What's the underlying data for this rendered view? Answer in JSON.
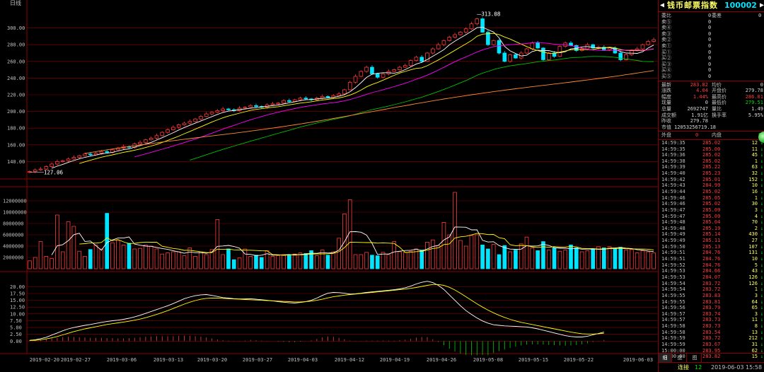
{
  "chart": {
    "period_label": "日线",
    "colors": {
      "up": "#ff3c3c",
      "down": "#00e5ff",
      "ma5": "#ffffff",
      "ma10": "#ffff00",
      "ma20": "#ff00ff",
      "ma60": "#00c000",
      "ma120": "#ff8c32",
      "grid": "#8b0000",
      "axis": "#c0c0c0"
    },
    "price_axis": {
      "min": 120,
      "max": 320,
      "ticks": [
        140,
        160,
        180,
        200,
        220,
        240,
        260,
        280,
        300
      ]
    },
    "volume_axis": {
      "max": 13000000,
      "ticks": [
        "2000000",
        "4000000",
        "6000000",
        "8000000",
        "10000000",
        "12000000"
      ]
    },
    "indicator_axis": {
      "min": -2,
      "max": 24,
      "ticks": [
        "0.00",
        "2.50",
        "5.00",
        "7.50",
        "10.00",
        "12.50",
        "15.00",
        "17.50",
        "20.00"
      ]
    },
    "dates": [
      "2019-02-20",
      "2019-02-27",
      "2019-03-06",
      "2019-03-13",
      "2019-03-20",
      "2019-03-27",
      "2019-04-03",
      "2019-04-12",
      "2019-04-19",
      "2019-04-26",
      "2019-05-08",
      "2019-05-15",
      "2019-05-22",
      "2019-06-03"
    ],
    "high_label": "313.08",
    "low_label": "127.06"
  },
  "chart_data": {
    "type": "candlestick",
    "closes": [
      128,
      130,
      131,
      134,
      137,
      140,
      141,
      143,
      145,
      147,
      149,
      148,
      150,
      152,
      151,
      154,
      156,
      158,
      157,
      161,
      163,
      166,
      168,
      171,
      175,
      178,
      181,
      184,
      186,
      188,
      191,
      194,
      197,
      199,
      201,
      203,
      202,
      201,
      204,
      205,
      207,
      206,
      205,
      208,
      209,
      210,
      213,
      212,
      214,
      216,
      215,
      214,
      216,
      218,
      217,
      219,
      221,
      226,
      235,
      242,
      248,
      253,
      245,
      241,
      245,
      248,
      250,
      253,
      255,
      261,
      265,
      260,
      270,
      275,
      280,
      285,
      289,
      292,
      295,
      299,
      305,
      311,
      295,
      280,
      285,
      270,
      260,
      268,
      264,
      270,
      275,
      282,
      276,
      262,
      270,
      266,
      278,
      282,
      279,
      273,
      275,
      280,
      276,
      277,
      274,
      276,
      270,
      262,
      268,
      273,
      275,
      280,
      284,
      286
    ],
    "volumes": [
      1400000,
      2000000,
      4800000,
      2200000,
      1800000,
      9500000,
      3000000,
      8300000,
      7500000,
      3100000,
      2200000,
      3400000,
      4200000,
      3500000,
      9800000,
      4600000,
      5000000,
      4200000,
      4500000,
      3500000,
      3600000,
      4200000,
      4000000,
      3500000,
      2600000,
      2800000,
      3000000,
      3000000,
      2300000,
      3700000,
      2200000,
      3000000,
      2500000,
      3400000,
      8700000,
      2500000,
      3500000,
      1600000,
      1900000,
      3500000,
      2200000,
      2400000,
      2000000,
      3200000,
      2200000,
      2300000,
      2500000,
      2400000,
      2600000,
      2800000,
      2700000,
      3200000,
      2300000,
      3300000,
      2400000,
      3000000,
      5400000,
      9700000,
      12200000,
      2500000,
      2500000,
      2900000,
      2400000,
      2300000,
      2900000,
      2500000,
      4800000,
      3000000,
      2900000,
      3100000,
      3500000,
      3300000,
      4700000,
      5100000,
      4100000,
      8200000,
      6000000,
      13500000,
      5000000,
      4000000,
      5900000,
      6000000,
      4200000,
      3500000,
      4300000,
      2500000,
      4100000,
      3000000,
      3300000,
      4400000,
      5600000,
      3700000,
      3200000,
      4800000,
      3300000,
      3700000,
      3100000,
      3300000,
      4200000,
      3700000,
      3000000,
      3200000,
      3400000,
      3900000,
      3700000,
      3900000,
      3500000,
      3800000,
      3300000,
      3400000,
      2800000,
      3200000,
      3000000,
      2800000
    ],
    "indicator_line1": [
      0.3,
      0.5,
      0.9,
      1.4,
      2.2,
      3.0,
      3.8,
      4.5,
      5.0,
      5.4,
      5.8,
      6.1,
      6.5,
      6.9,
      7.2,
      7.5,
      7.7,
      8.0,
      8.4,
      8.9,
      9.5,
      10.2,
      10.9,
      11.6,
      12.3,
      13.0,
      13.8,
      14.7,
      15.6,
      16.2,
      16.7,
      17.0,
      17.1,
      16.8,
      16.4,
      16.0,
      15.8,
      15.6,
      15.5,
      15.5,
      15.6,
      15.4,
      15.2,
      15.0,
      14.8,
      14.5,
      14.3,
      14.1,
      14.0,
      14.2,
      14.5,
      15.0,
      15.8,
      16.8,
      17.6,
      17.9,
      17.8,
      17.6,
      17.3,
      17.4,
      17.6,
      17.9,
      18.1,
      18.3,
      18.5,
      18.7,
      18.9,
      19.2,
      19.6,
      20.2,
      21.0,
      21.6,
      22.0,
      21.5,
      20.5,
      19.0,
      17.0,
      15.0,
      13.0,
      11.2,
      9.8,
      8.5,
      7.4,
      6.6,
      6.0,
      5.8,
      5.6,
      5.5,
      5.4,
      5.3,
      5.2,
      4.9,
      4.5,
      4.0,
      3.5,
      3.0,
      2.5,
      2.0,
      1.7,
      1.5,
      1.5,
      1.8,
      2.3,
      2.8,
      3.3
    ],
    "indicator_line2": [
      0.2,
      0.3,
      0.5,
      0.8,
      1.2,
      1.7,
      2.3,
      2.9,
      3.5,
      4.0,
      4.5,
      4.9,
      5.3,
      5.7,
      6.1,
      6.4,
      6.7,
      7.0,
      7.3,
      7.7,
      8.1,
      8.6,
      9.2,
      9.8,
      10.5,
      11.2,
      12.0,
      12.8,
      13.6,
      14.3,
      14.9,
      15.4,
      15.7,
      15.8,
      15.8,
      15.7,
      15.6,
      15.5,
      15.4,
      15.3,
      15.2,
      15.1,
      15.0,
      14.9,
      14.8,
      14.7,
      14.6,
      14.5,
      14.4,
      14.4,
      14.5,
      14.7,
      15.0,
      15.4,
      15.9,
      16.3,
      16.6,
      16.9,
      17.1,
      17.3,
      17.5,
      17.7,
      17.9,
      18.1,
      18.3,
      18.5,
      18.7,
      18.9,
      19.1,
      19.4,
      19.7,
      20.1,
      20.5,
      20.8,
      20.8,
      20.5,
      19.8,
      18.8,
      17.6,
      16.3,
      15.0,
      13.7,
      12.5,
      11.4,
      10.4,
      9.5,
      8.7,
      8.0,
      7.4,
      6.9,
      6.5,
      6.1,
      5.7,
      5.3,
      4.9,
      4.5,
      4.1,
      3.7,
      3.3,
      3.0,
      2.7,
      2.6,
      2.6,
      2.7,
      2.9
    ],
    "macd_bars": [
      0.3,
      0.4,
      0.6,
      0.8,
      1.0,
      1.2,
      1.5,
      1.6,
      1.5,
      1.4,
      1.3,
      1.2,
      1.2,
      1.2,
      1.1,
      1.1,
      1.0,
      1.0,
      1.1,
      1.2,
      1.4,
      1.6,
      1.7,
      1.8,
      1.8,
      1.8,
      1.8,
      1.9,
      2.0,
      1.9,
      1.8,
      1.6,
      1.4,
      1.0,
      0.6,
      0.3,
      0.2,
      0.1,
      0.1,
      0.2,
      0.4,
      0.3,
      0.2,
      0.1,
      0.0,
      -0.2,
      -0.3,
      -0.4,
      -0.4,
      -0.2,
      0.0,
      0.3,
      0.8,
      1.4,
      1.7,
      1.6,
      1.2,
      0.7,
      0.2,
      0.1,
      0.1,
      0.2,
      0.2,
      0.2,
      0.2,
      0.2,
      0.2,
      0.3,
      0.5,
      0.8,
      1.3,
      1.5,
      1.5,
      0.7,
      -0.3,
      -1.5,
      -2.8,
      -3.8,
      -4.6,
      -5.1,
      -5.2,
      -5.2,
      -5.1,
      -5.2,
      -4.4,
      -3.7,
      -3.1,
      -2.5,
      -2.0,
      -1.6,
      -1.3,
      -1.2,
      -1.2,
      -1.3,
      -1.4,
      -1.5,
      -1.6,
      -1.7,
      -1.6,
      -1.5,
      -1.2,
      -0.8,
      -0.3,
      0.1,
      0.4
    ]
  },
  "panel": {
    "name": "钱币邮票指数",
    "code": "100002",
    "order_book": [
      {
        "label": "委比",
        "v1": "0",
        "label2": "委差",
        "v2": "0"
      },
      {
        "label": "卖⑤",
        "v1": "",
        "v2": "0"
      },
      {
        "label": "卖④",
        "v1": "",
        "v2": "0"
      },
      {
        "label": "卖③",
        "v1": "",
        "v2": "0"
      },
      {
        "label": "卖②",
        "v1": "",
        "v2": "0"
      },
      {
        "label": "卖①",
        "v1": "",
        "v2": "0"
      },
      {
        "label": "买①",
        "v1": "",
        "v2": "0"
      },
      {
        "label": "买②",
        "v1": "",
        "v2": "0"
      },
      {
        "label": "买③",
        "v1": "",
        "v2": "0"
      },
      {
        "label": "买④",
        "v1": "",
        "v2": "0"
      },
      {
        "label": "买⑤",
        "v1": "",
        "v2": "0"
      }
    ],
    "quote": [
      {
        "l1": "最新",
        "v1": "283.82",
        "c1": "red",
        "l2": "均价",
        "v2": "0",
        "c2": "white"
      },
      {
        "l1": "涨跌",
        "v1": "4.04",
        "c1": "red",
        "l2": "开盘价",
        "v2": "279.78",
        "c2": "white"
      },
      {
        "l1": "幅度",
        "v1": "1.44%",
        "c1": "red",
        "l2": "最高价",
        "v2": "286.01",
        "c2": "red"
      },
      {
        "l1": "现量",
        "v1": "0",
        "c1": "white",
        "l2": "最低价",
        "v2": "279.51",
        "c2": "green"
      },
      {
        "l1": "总量",
        "v1": "2692747",
        "c1": "white",
        "l2": "量比",
        "v2": "1.49",
        "c2": "white"
      },
      {
        "l1": "成交额",
        "v1": "1.91亿",
        "c1": "white",
        "l2": "换手率",
        "v2": "5.95%",
        "c2": "white"
      },
      {
        "l1": "昨收",
        "v1": "279.78",
        "c1": "white",
        "l2": "",
        "v2": "",
        "c2": "white"
      },
      {
        "l1": "市值",
        "v1": "12053256719.18",
        "c1": "white",
        "l2": "",
        "v2": "",
        "c2": "white"
      }
    ],
    "inout": {
      "out_label": "外盘",
      "out": "0",
      "in_label": "内盘",
      "in": "0"
    },
    "trades": [
      {
        "t": "14:59:35",
        "p": "285.02",
        "v": "12",
        "d": "↓"
      },
      {
        "t": "14:59:35",
        "p": "285.00",
        "v": "11",
        "d": "↓"
      },
      {
        "t": "14:59:36",
        "p": "285.02",
        "v": "45",
        "d": "↓"
      },
      {
        "t": "14:59:38",
        "p": "285.02",
        "v": "1",
        "d": "↓"
      },
      {
        "t": "14:59:39",
        "p": "285.22",
        "v": "63",
        "d": "↓"
      },
      {
        "t": "14:59:40",
        "p": "285.23",
        "v": "32",
        "d": "↓"
      },
      {
        "t": "14:59:42",
        "p": "285.01",
        "v": "152",
        "d": "↓"
      },
      {
        "t": "14:59:43",
        "p": "284.99",
        "v": "10",
        "d": "↓"
      },
      {
        "t": "14:59:44",
        "p": "285.02",
        "v": "16",
        "d": "↓"
      },
      {
        "t": "14:59:46",
        "p": "285.05",
        "v": "1",
        "d": "↓"
      },
      {
        "t": "14:59:46",
        "p": "285.02",
        "v": "30",
        "d": "↓"
      },
      {
        "t": "14:59:47",
        "p": "285.09",
        "v": "3",
        "d": "↓"
      },
      {
        "t": "14:59:47",
        "p": "285.09",
        "v": "4",
        "d": "↓"
      },
      {
        "t": "14:59:48",
        "p": "285.04",
        "v": "70",
        "d": "↓"
      },
      {
        "t": "14:59:48",
        "p": "285.19",
        "v": "2",
        "d": "↓"
      },
      {
        "t": "14:59:49",
        "p": "285.14",
        "v": "430",
        "d": "↓"
      },
      {
        "t": "14:59:49",
        "p": "285.11",
        "v": "27",
        "d": "↓"
      },
      {
        "t": "14:59:50",
        "p": "285.13",
        "v": "107",
        "d": "↓"
      },
      {
        "t": "14:59:51",
        "p": "284.76",
        "v": "131",
        "d": "↓"
      },
      {
        "t": "14:59:51",
        "p": "284.76",
        "v": "10",
        "d": "↓"
      },
      {
        "t": "14:59:52",
        "p": "284.76",
        "v": "5",
        "d": "↓"
      },
      {
        "t": "14:59:53",
        "p": "284.66",
        "v": "43",
        "d": "↓"
      },
      {
        "t": "14:59:53",
        "p": "284.07",
        "v": "126",
        "d": "↓"
      },
      {
        "t": "14:59:54",
        "p": "283.72",
        "v": "126",
        "d": "↓"
      },
      {
        "t": "14:59:54",
        "p": "283.72",
        "v": "1",
        "d": "↓"
      },
      {
        "t": "14:59:55",
        "p": "283.83",
        "v": "3",
        "d": "↓"
      },
      {
        "t": "14:59:55",
        "p": "283.81",
        "v": "64",
        "d": "↓"
      },
      {
        "t": "14:59:56",
        "p": "283.79",
        "v": "65",
        "d": "↓"
      },
      {
        "t": "14:59:57",
        "p": "283.74",
        "v": "3",
        "d": "↓"
      },
      {
        "t": "14:59:57",
        "p": "283.73",
        "v": "11",
        "d": "↓"
      },
      {
        "t": "14:59:58",
        "p": "283.73",
        "v": "8",
        "d": "↓"
      },
      {
        "t": "14:59:58",
        "p": "283.54",
        "v": "13",
        "d": "↓"
      },
      {
        "t": "14:59:59",
        "p": "283.72",
        "v": "212",
        "d": "↓"
      },
      {
        "t": "14:59:59",
        "p": "283.67",
        "v": "31",
        "d": "↓"
      },
      {
        "t": "15:00:00",
        "p": "283.95",
        "v": "62",
        "d": "↓"
      },
      {
        "t": "15:00:00",
        "p": "283.82",
        "v": "15",
        "d": "↓"
      }
    ],
    "tabs": [
      "细",
      "盘",
      "图"
    ],
    "status": {
      "label": "连接",
      "count": "12",
      "datetime": "2019-06-03 15:58"
    }
  }
}
